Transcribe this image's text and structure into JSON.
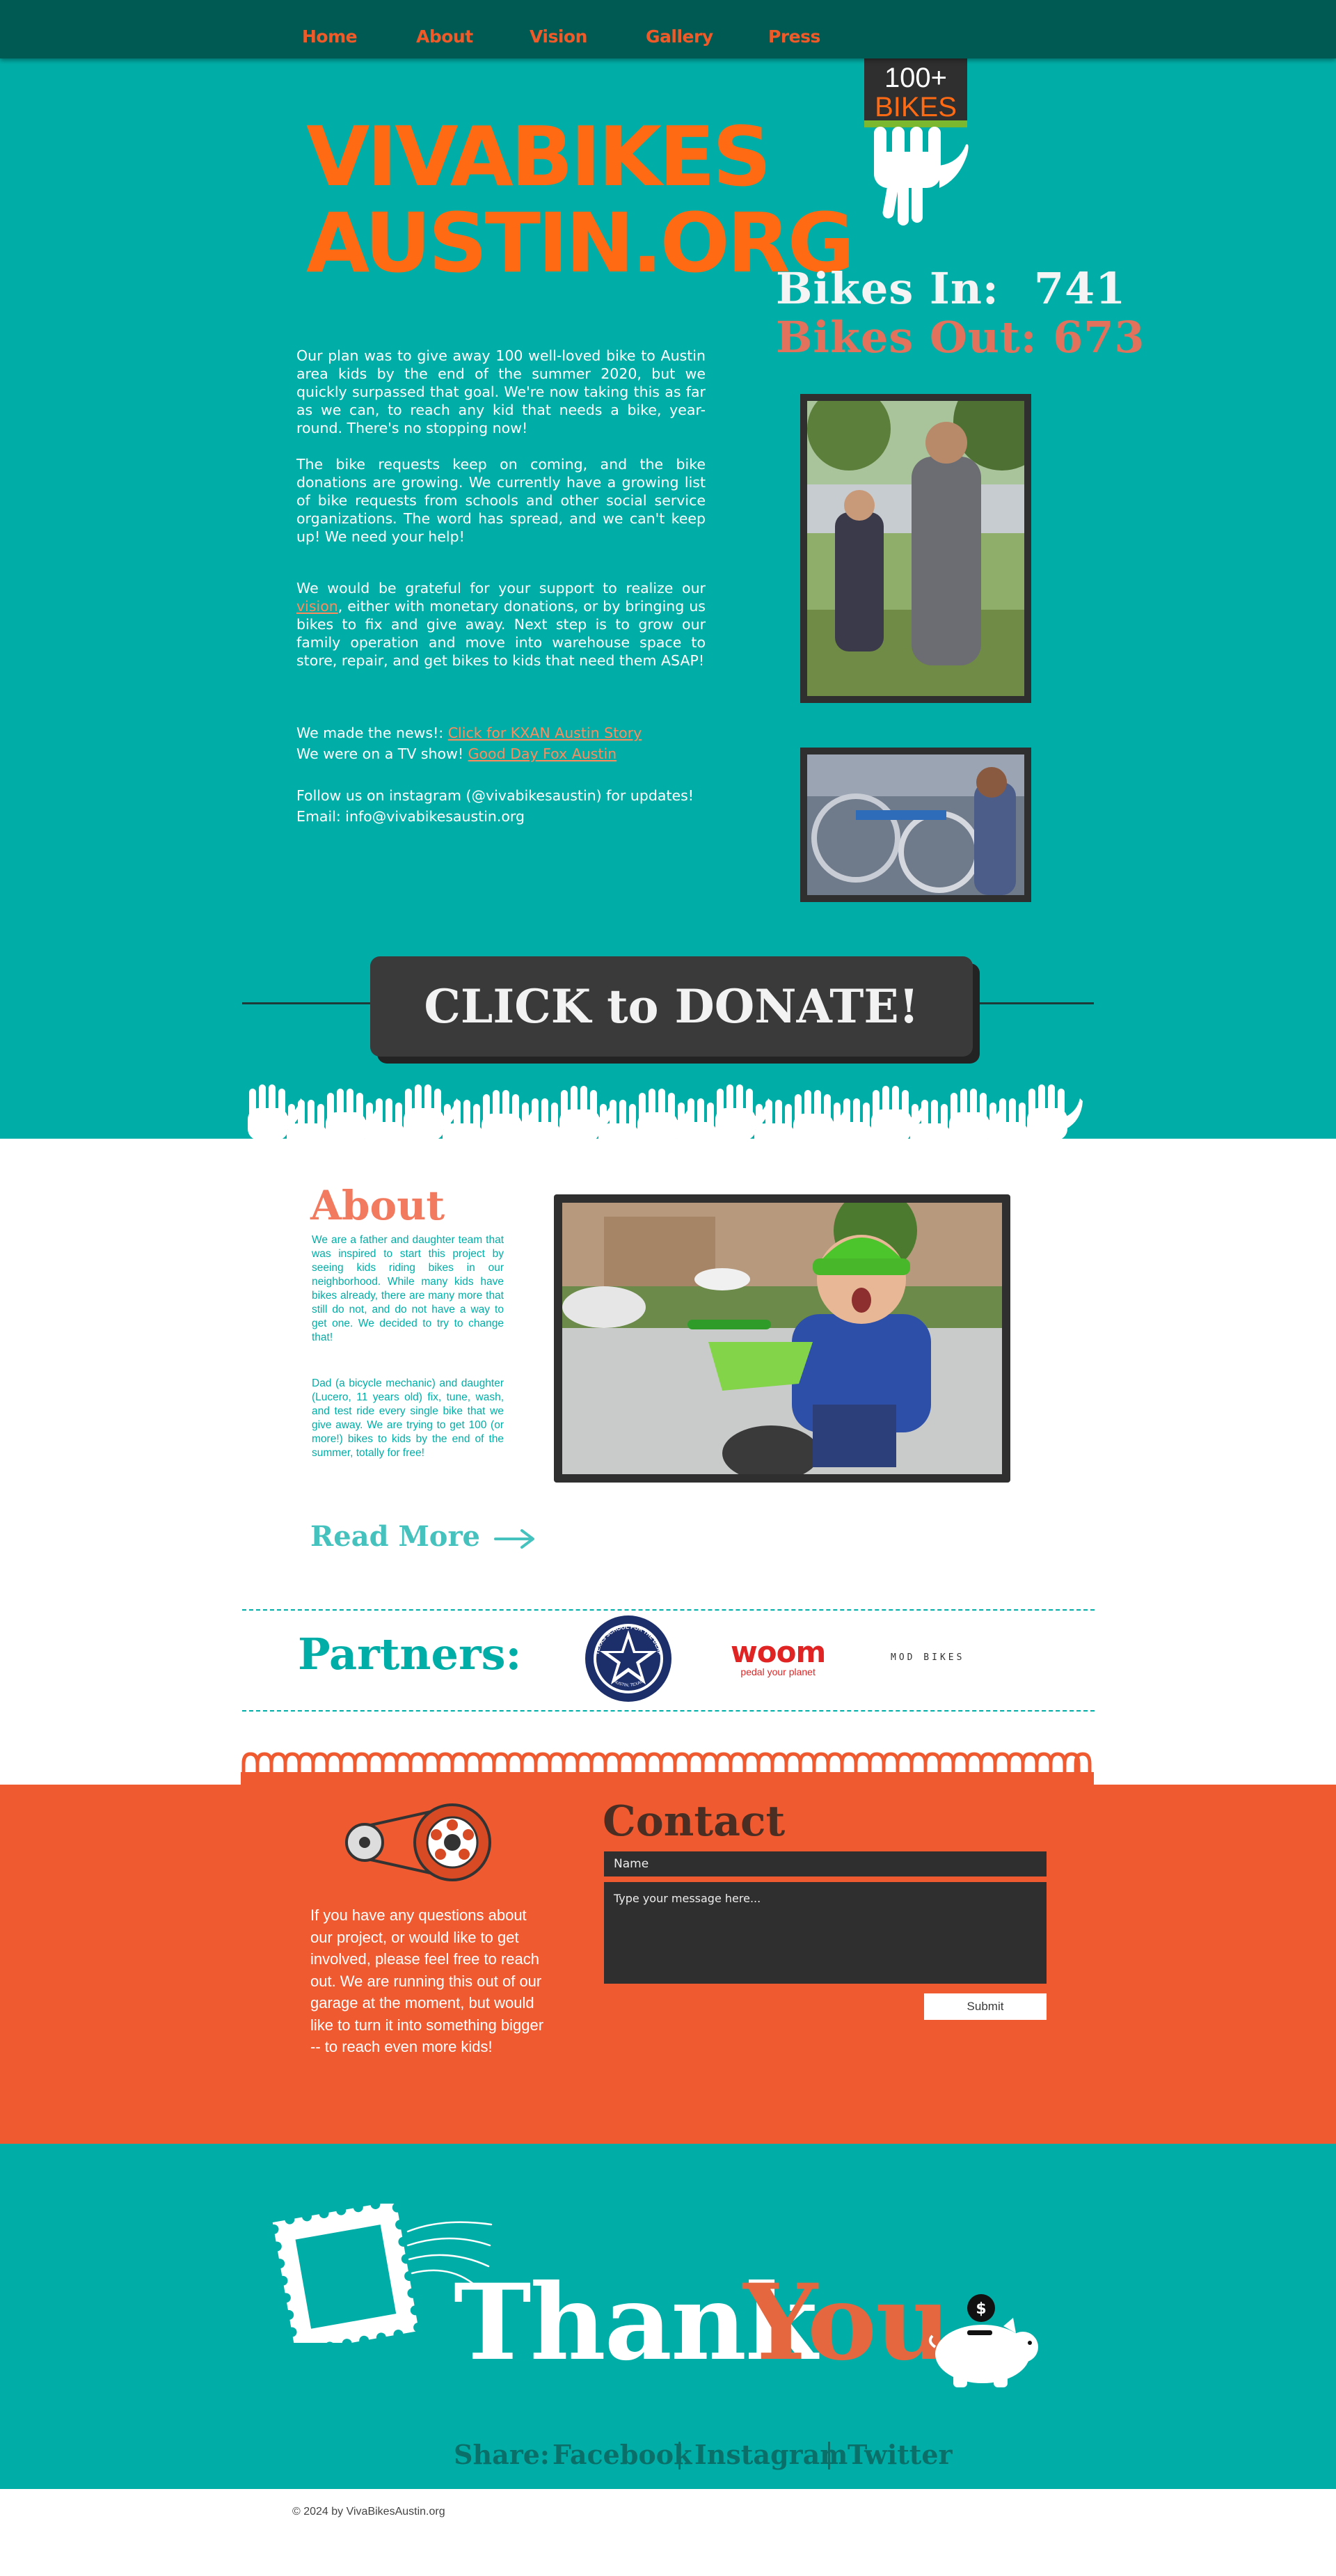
{
  "nav": {
    "items": [
      "Home",
      "About",
      "Vision",
      "Gallery",
      "Press"
    ]
  },
  "hero": {
    "logo_line1": "VIVABIKES",
    "logo_line2": "AUSTIN.ORG",
    "badge": {
      "count": "100+",
      "label": "BIKES"
    },
    "stats": {
      "bikes_in_label": "Bikes In:",
      "bikes_in_value": "741",
      "bikes_out_label": "Bikes Out:",
      "bikes_out_value": "673"
    },
    "para1": "Our plan was to give away 100 well-loved bike to Austin area kids by the end of the summer 2020, but we quickly surpassed that goal.  We're now taking this as far as we can, to reach any kid that needs a bike, year-round.  There's no stopping now!",
    "para2": "The bike requests keep on coming, and the bike donations are growing.  We currently have a growing list of bike requests from schools and other social service organizations.  The word has spread, and we can't keep up!  We need your help!",
    "para3_before": "We would be grateful for your support to realize our ",
    "para3_link": "vision",
    "para3_after": ", either with monetary donations, or by bringing us bikes to fix and give away.   Next step is to grow our family operation and move into warehouse space to store, repair, and get bikes to kids that need them ASAP!",
    "news_prefix": "We made the news!: ",
    "news_link": "Click for KXAN Austin Story",
    "tv_prefix": "We were on a TV show! ",
    "tv_link": "Good Day Fox Austin",
    "instagram_text": "Follow us on instagram (@vivabikesaustin) for updates!",
    "email_text": "Email: info@vivabikesaustin.org",
    "donate_label": "CLICK to DONATE!"
  },
  "about": {
    "title": "About",
    "para1": "We are a father and daughter team that was inspired to start this project by seeing kids riding bikes in our neighborhood. While many  kids have bikes already, there are many more that still do not, and do not have a way to get one. We decided to try to change that!",
    "para2": "Dad (a bicycle mechanic) and daughter (Lucero, 11 years old) fix, tune, wash, and test ride every single bike that we give away.  We are trying to get 100 (or more!) bikes to kids by the end of the summer, totally for free!",
    "read_more": "Read More"
  },
  "partners": {
    "title": "Partners:",
    "school_badge": "TEXAS SCHOOL FOR THE DEAF",
    "school_tag": "AUSTIN, TEXAS",
    "woom_name": "woom",
    "woom_tagline": "pedal your planet",
    "mod_name": "MOD BIKES"
  },
  "contact": {
    "title": "Contact",
    "name_placeholder": "Name",
    "message_placeholder": "Type your message here...",
    "submit_label": "Submit",
    "text": "If you have any questions about our project, or would like to get involved, please feel free to reach out.  We are running this out of our garage at the moment,  but would like to turn it into something bigger -- to reach even more kids!"
  },
  "thanks": {
    "word_thank": "Thank",
    "word_you": "You",
    "share_label": "Share:",
    "share_items": [
      "Facebook",
      "Instagram",
      "Twitter"
    ]
  },
  "footer": {
    "copyright": "© 2024 by VivaBikesAustin.org"
  },
  "colors": {
    "teal": "#00AEA7",
    "dark_teal": "#005A54",
    "orange": "#FF6A13",
    "coral": "#F05A30",
    "charcoal": "#2F2F2F"
  }
}
